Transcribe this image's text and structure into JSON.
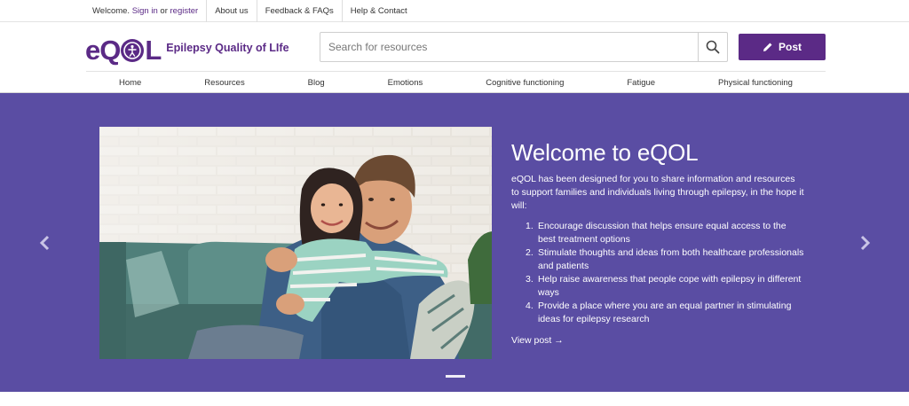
{
  "topbar": {
    "welcome": "Welcome.",
    "sign_in": "Sign in",
    "or": "or",
    "register": "register",
    "about": "About us",
    "feedback": "Feedback & FAQs",
    "help": "Help & Contact"
  },
  "header": {
    "logo_text_left": "eQ",
    "logo_text_right": "L",
    "logo_tagline": "Epilepsy Quality of LIfe",
    "search_placeholder": "Search for resources",
    "post_label": "Post"
  },
  "nav": {
    "items": [
      "Home",
      "Resources",
      "Blog",
      "Emotions",
      "Cognitive functioning",
      "Fatigue",
      "Physical functioning"
    ]
  },
  "hero": {
    "title": "Welcome to eQOL",
    "intro": "eQOL has been designed for you to share information and resources to support families and individuals living through epilepsy, in the hope it will:",
    "list": [
      {
        "num": "1.",
        "text": "Encourage discussion that helps ensure equal access to the best treatment options"
      },
      {
        "num": "2.",
        "text": "Stimulate thoughts and ideas from both healthcare professionals and patients"
      },
      {
        "num": "3.",
        "text": "Help raise awareness that people cope with epilepsy in different ways"
      },
      {
        "num": "4.",
        "text": "Provide a place where you are an equal partner in stimulating ideas for epilepsy research"
      }
    ],
    "view_post": "View post →"
  },
  "icons": {
    "search": "search-icon",
    "pencil": "pencil-icon",
    "prev": "chevron-left-icon",
    "next": "chevron-right-icon"
  },
  "colors": {
    "brand": "#5b2a86",
    "hero_bg": "#5a4da3"
  }
}
